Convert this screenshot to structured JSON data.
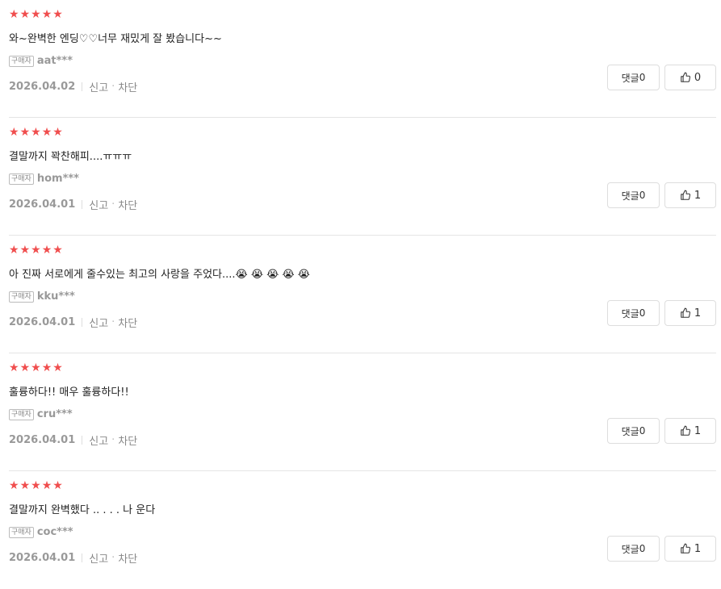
{
  "reviews": [
    {
      "rating": 5,
      "content": "와~완벽한 엔딩♡♡너무 재밌게 잘 봤습니다~~",
      "buyer_badge": "구매자",
      "username": "aat***",
      "date": "2026.04.02",
      "report_label": "신고",
      "block_label": "차단",
      "comment_label": "댓글",
      "comment_count": "0",
      "like_count": "0"
    },
    {
      "rating": 5,
      "content": "결말까지 꽉찬해피....ㅠㅠㅠ",
      "buyer_badge": "구매자",
      "username": "hom***",
      "date": "2026.04.01",
      "report_label": "신고",
      "block_label": "차단",
      "comment_label": "댓글",
      "comment_count": "0",
      "like_count": "1"
    },
    {
      "rating": 5,
      "content": "아 진짜 서로에게 줄수있는 최고의 사랑을 주었다....😭 😭 😭 😭 😭",
      "buyer_badge": "구매자",
      "username": "kku***",
      "date": "2026.04.01",
      "report_label": "신고",
      "block_label": "차단",
      "comment_label": "댓글",
      "comment_count": "0",
      "like_count": "1"
    },
    {
      "rating": 5,
      "content": "훌륭하다!! 매우 훌륭하다!!",
      "buyer_badge": "구매자",
      "username": "cru***",
      "date": "2026.04.01",
      "report_label": "신고",
      "block_label": "차단",
      "comment_label": "댓글",
      "comment_count": "0",
      "like_count": "1"
    },
    {
      "rating": 5,
      "content": "결말까지 완벽했다 .. . . . 나 운다",
      "buyer_badge": "구매자",
      "username": "coc***",
      "date": "2026.04.01",
      "report_label": "신고",
      "block_label": "차단",
      "comment_label": "댓글",
      "comment_count": "0",
      "like_count": "1"
    }
  ],
  "icons": {
    "star": "star-icon",
    "like": "thumbs-up-icon"
  },
  "colors": {
    "star": "#f04e4e",
    "divider": "#e5e5e5",
    "meta_text": "#888888"
  }
}
